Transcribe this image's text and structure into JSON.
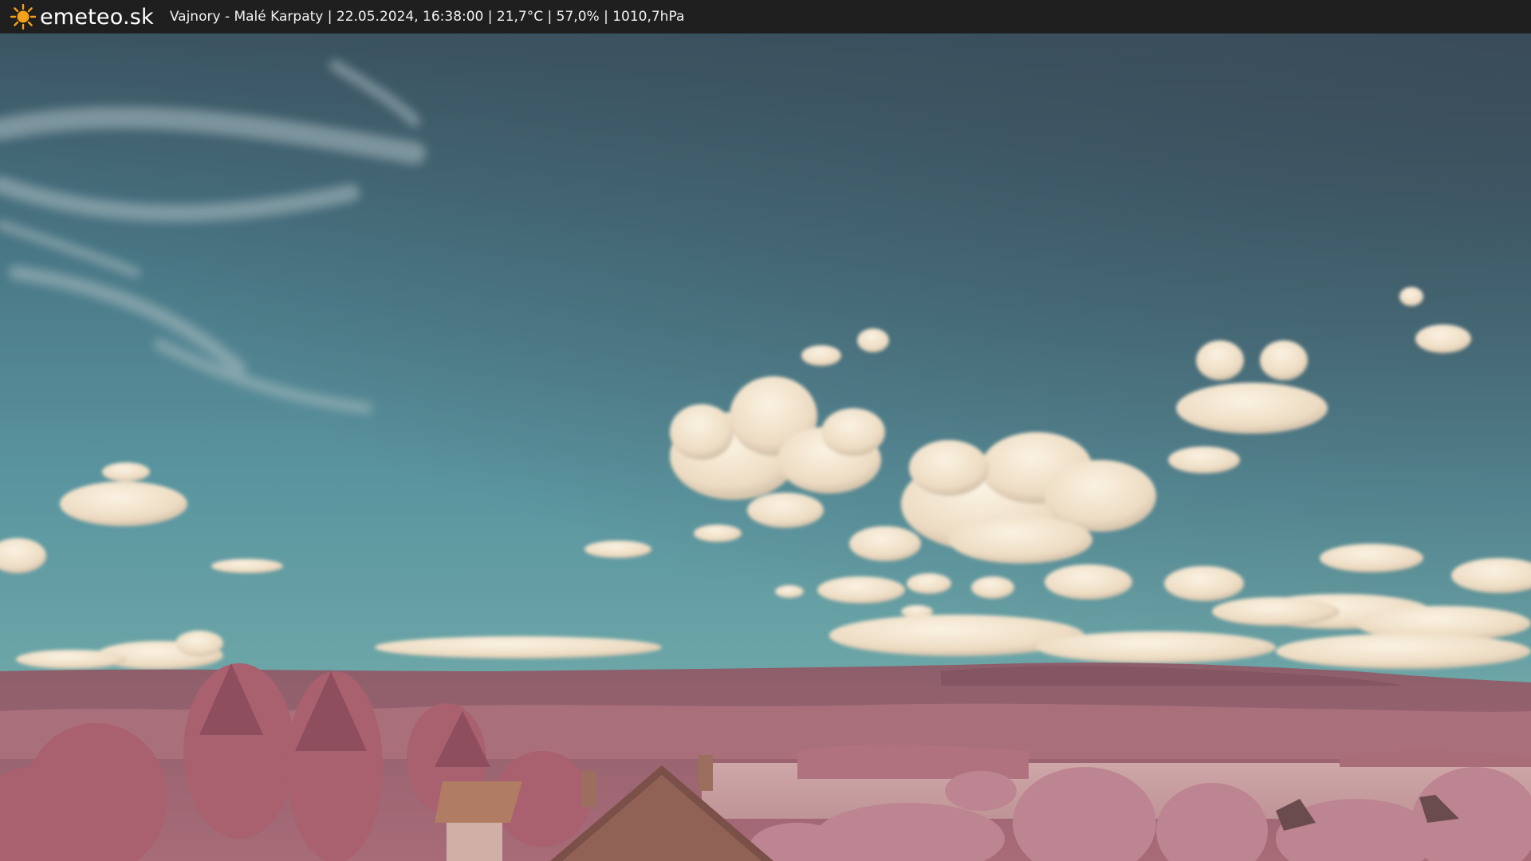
{
  "header": {
    "brand": "emeteo.sk",
    "logo_icon": "sun-icon",
    "caption": "Vajnory - Malé Karpaty | 22.05.2024, 16:38:00 | 21,7°C | 57,0% | 1010,7hPa"
  },
  "colors": {
    "topbar": "#1f1f1f",
    "sun": "#f4a11a",
    "sky_top": "#3e5766",
    "sky_horizon": "#5c98a0",
    "foliage": "#b8727f"
  }
}
